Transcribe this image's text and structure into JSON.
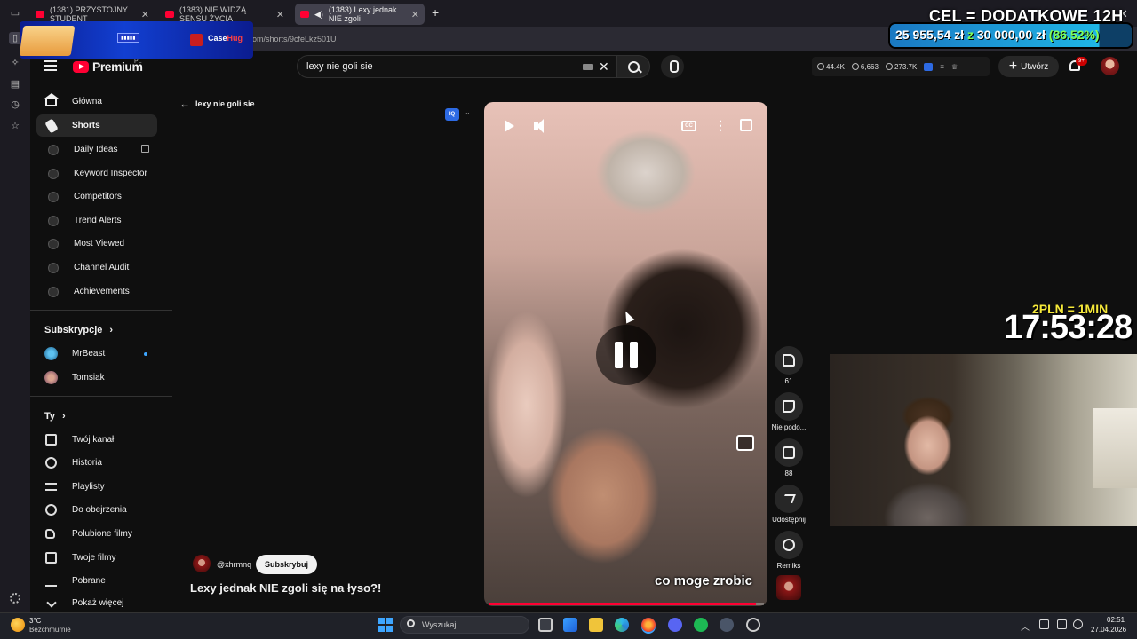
{
  "browser": {
    "tabs": [
      {
        "label": "(1381) PRZYSTOJNY STUDENT"
      },
      {
        "label": "(1383) NIE WIDZĄ SENSU ŻYCIA"
      },
      {
        "label": "(1383) Lexy jednak NIE zgoli"
      }
    ],
    "new_tab": "+",
    "close": "✕",
    "url": "om/shorts/9cfeLkz501U"
  },
  "youtube": {
    "logo_text": "Premium",
    "logo_region": "PL",
    "search": {
      "value": "lexy nie goli sie"
    },
    "stats": {
      "a": "44.4K",
      "b": "6,663",
      "c": "273.7K"
    },
    "create_label": "Utwórz",
    "notifications": "9+",
    "sidebar": {
      "main": [
        {
          "label": "Główna"
        },
        {
          "label": "Shorts"
        },
        {
          "label": "Daily Ideas"
        },
        {
          "label": "Keyword Inspector"
        },
        {
          "label": "Competitors"
        },
        {
          "label": "Trend Alerts"
        },
        {
          "label": "Most Viewed"
        },
        {
          "label": "Channel Audit"
        },
        {
          "label": "Achievements"
        }
      ],
      "subs_heading": "Subskrypcje",
      "subs": [
        {
          "label": "MrBeast"
        },
        {
          "label": "Tomsiak"
        }
      ],
      "you_heading": "Ty",
      "you": [
        {
          "label": "Twój kanał"
        },
        {
          "label": "Historia"
        },
        {
          "label": "Playlisty"
        },
        {
          "label": "Do obejrzenia"
        },
        {
          "label": "Polubione filmy"
        },
        {
          "label": "Twoje filmy"
        },
        {
          "label": "Pobrane"
        },
        {
          "label": "Pokaż więcej"
        }
      ]
    },
    "back_label": "lexy nie goli sie",
    "iq_badge": "IQ",
    "video": {
      "cc": "CC",
      "caption": "co moge zrobic",
      "progress": 0.97
    },
    "channel": {
      "handle": "@xhrmnq",
      "subscribe": "Subskrybuj"
    },
    "title": "Lexy jednak NIE zgoli się na łyso?!",
    "actions": {
      "likes": "61",
      "dislike": "Nie podo...",
      "comments": "88",
      "share": "Udostępnij",
      "remix": "Remiks"
    }
  },
  "overlay": {
    "promo_text_a": "Case",
    "promo_text_b": "Hug",
    "goal_title": "CEL = DODATKOWE 12H",
    "goal_current": "25 955,54 zł",
    "goal_z": "z",
    "goal_target": "30 000,00 zł",
    "goal_pct": "(86.52%)",
    "goal_progress": 0.8652,
    "rate": "2PLN = 1MIN",
    "timer": "17:53:28"
  },
  "taskbar": {
    "temp": "3°C",
    "weather": "Bezchmurnie",
    "search": "Wyszukaj",
    "time": "02:51",
    "date": "27.04.2026"
  }
}
